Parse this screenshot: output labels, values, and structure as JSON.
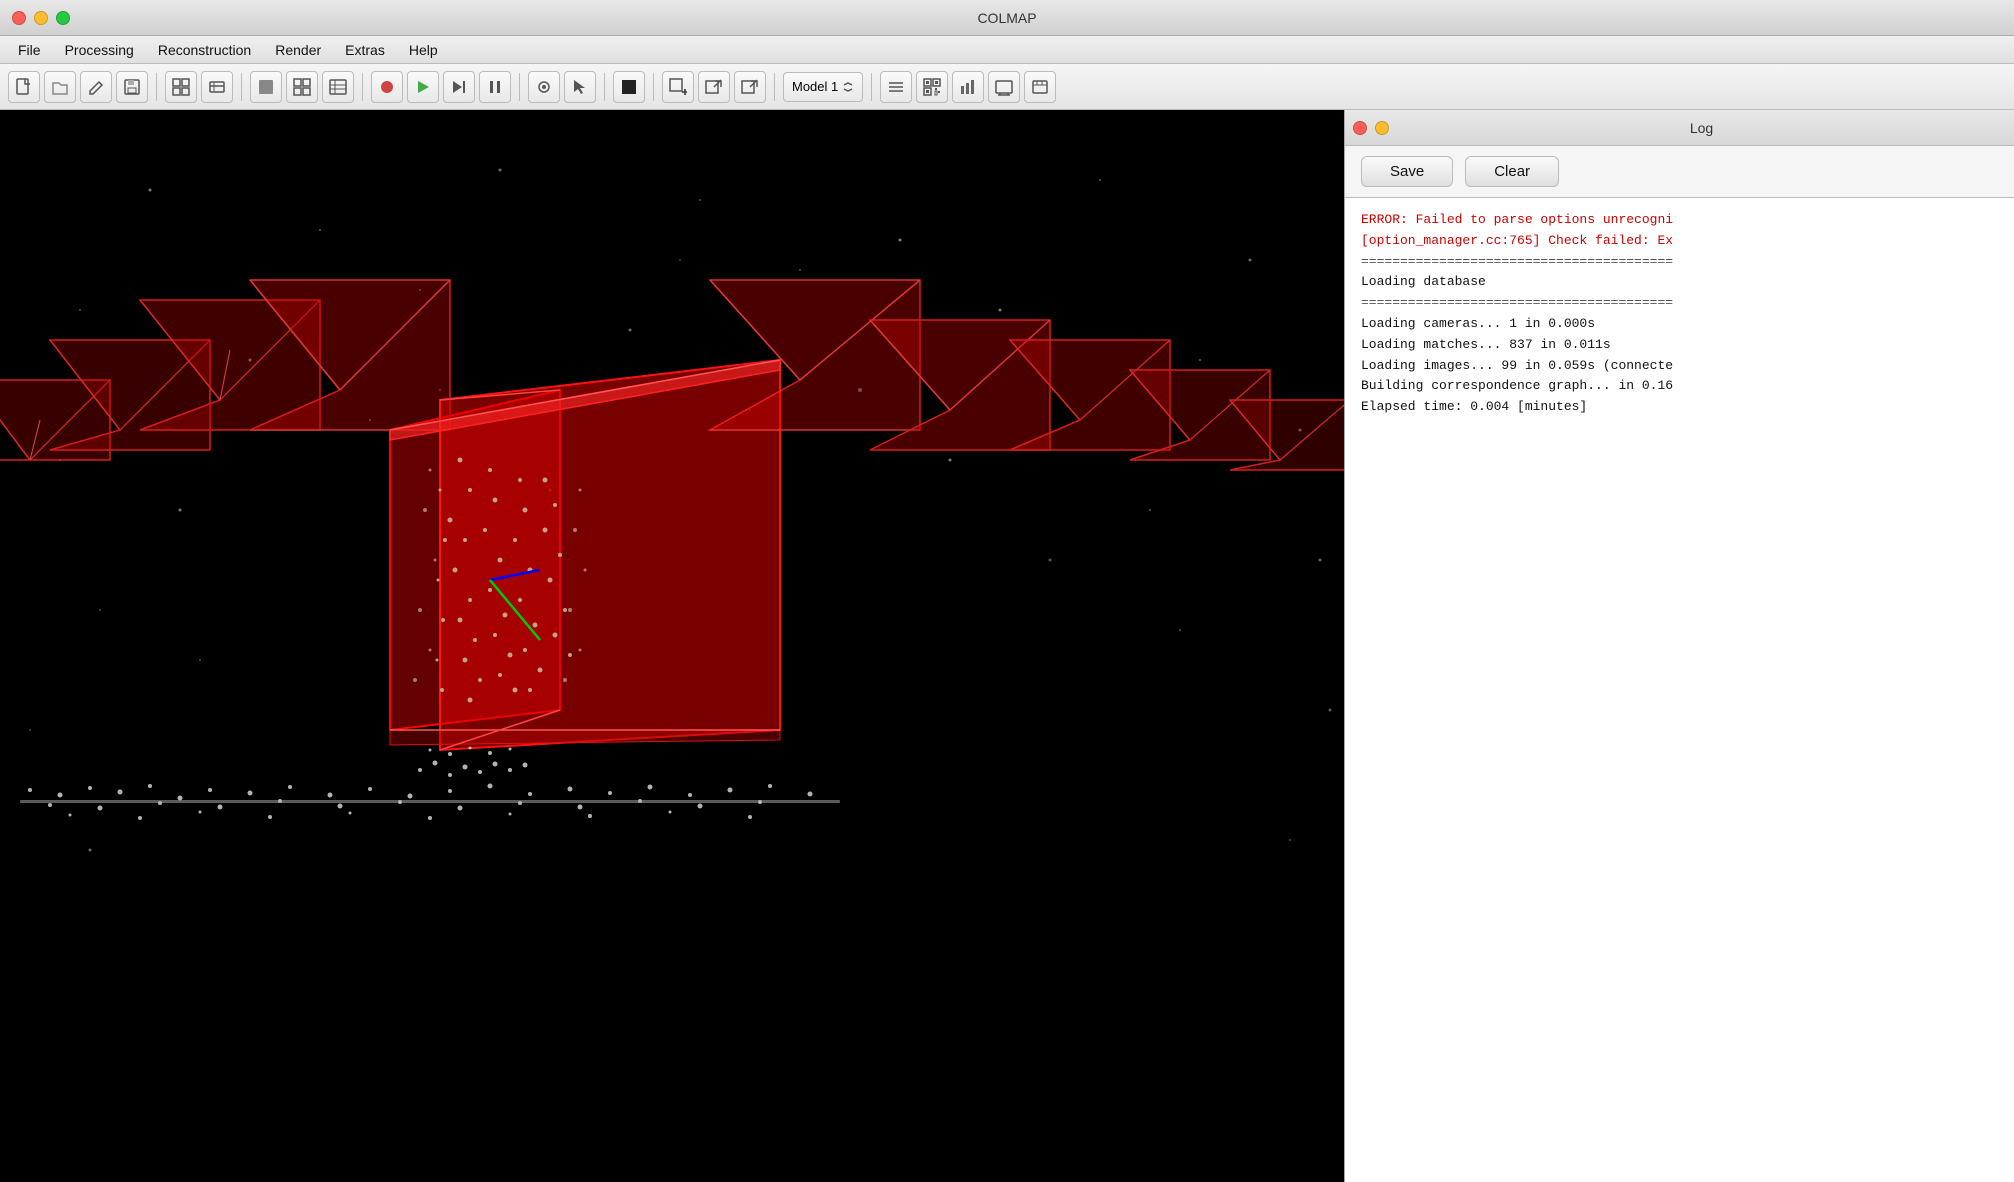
{
  "window": {
    "title": "COLMAP"
  },
  "menu": {
    "items": [
      "File",
      "Processing",
      "Reconstruction",
      "Render",
      "Extras",
      "Help"
    ]
  },
  "toolbar": {
    "model_selector": {
      "label": "Model 1",
      "icon": "chevron-up-down"
    },
    "buttons": [
      {
        "name": "new",
        "icon": "📄"
      },
      {
        "name": "open",
        "icon": "📂"
      },
      {
        "name": "save-project",
        "icon": "✏️"
      },
      {
        "name": "save",
        "icon": "💾"
      },
      {
        "name": "import",
        "icon": "📥"
      },
      {
        "name": "export",
        "icon": "📤"
      },
      {
        "name": "view3d",
        "icon": "🖼"
      },
      {
        "name": "grid",
        "icon": "⊞"
      },
      {
        "name": "table",
        "icon": "⊟"
      },
      {
        "name": "record",
        "icon": "⏺"
      },
      {
        "name": "play",
        "icon": "▶"
      },
      {
        "name": "next",
        "icon": "⏭"
      },
      {
        "name": "pause",
        "icon": "⏸"
      },
      {
        "name": "camera",
        "icon": "📷"
      },
      {
        "name": "tool",
        "icon": "🔧"
      },
      {
        "name": "shape-black",
        "icon": "⬛"
      },
      {
        "name": "shape-add",
        "icon": "➕"
      },
      {
        "name": "shape-export",
        "icon": "📋"
      },
      {
        "name": "shape-import",
        "icon": "📑"
      },
      {
        "name": "list",
        "icon": "☰"
      },
      {
        "name": "qr",
        "icon": "⊞"
      },
      {
        "name": "chart",
        "icon": "📊"
      },
      {
        "name": "render",
        "icon": "🖥"
      },
      {
        "name": "settings",
        "icon": "⚙"
      }
    ]
  },
  "log_panel": {
    "title": "Log",
    "save_label": "Save",
    "clear_label": "Clear",
    "lines": [
      {
        "type": "error",
        "text": "ERROR: Failed to parse options unrecogni"
      },
      {
        "type": "error",
        "text": "[option_manager.cc:765] Check failed: Ex"
      },
      {
        "type": "blank",
        "text": ""
      },
      {
        "type": "separator",
        "text": "========================================"
      },
      {
        "type": "info",
        "text": "Loading database"
      },
      {
        "type": "separator",
        "text": "========================================"
      },
      {
        "type": "blank",
        "text": ""
      },
      {
        "type": "info",
        "text": "Loading cameras... 1 in 0.000s"
      },
      {
        "type": "info",
        "text": "Loading matches... 837 in 0.011s"
      },
      {
        "type": "info",
        "text": "Loading images... 99 in 0.059s (connecte"
      },
      {
        "type": "info",
        "text": "Building correspondence graph... in 0.16"
      },
      {
        "type": "blank",
        "text": ""
      },
      {
        "type": "info",
        "text": "Elapsed time: 0.004 [minutes]"
      }
    ]
  },
  "viewport": {
    "background": "#000000"
  }
}
